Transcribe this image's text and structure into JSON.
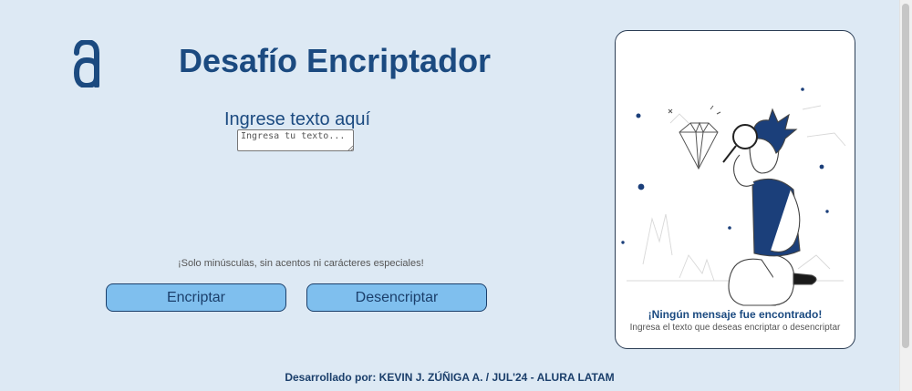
{
  "header": {
    "title": "Desafío Encriptador",
    "logo_icon": "alura-logo-icon"
  },
  "input": {
    "label": "Ingrese texto aquí",
    "placeholder": "Ingresa tu texto...",
    "value": ""
  },
  "hint": "¡Solo minúsculas, sin acentos ni carácteres especiales!",
  "buttons": {
    "encrypt_label": "Encriptar",
    "decrypt_label": "Desencriptar"
  },
  "output_panel": {
    "title": "¡Ningún mensaje fue encontrado!",
    "subtitle": "Ingresa el texto que deseas encriptar o desencriptar",
    "illustration": "person-with-magnifier-looking-at-diamond"
  },
  "footer": {
    "credit": "Desarrollado por: KEVIN J. ZÚÑIGA A. / JUL'24 - ALURA LATAM"
  },
  "colors": {
    "background": "#dde9f4",
    "primary": "#1b4a80",
    "button": "#7fbfee",
    "panel": "#ffffff"
  }
}
